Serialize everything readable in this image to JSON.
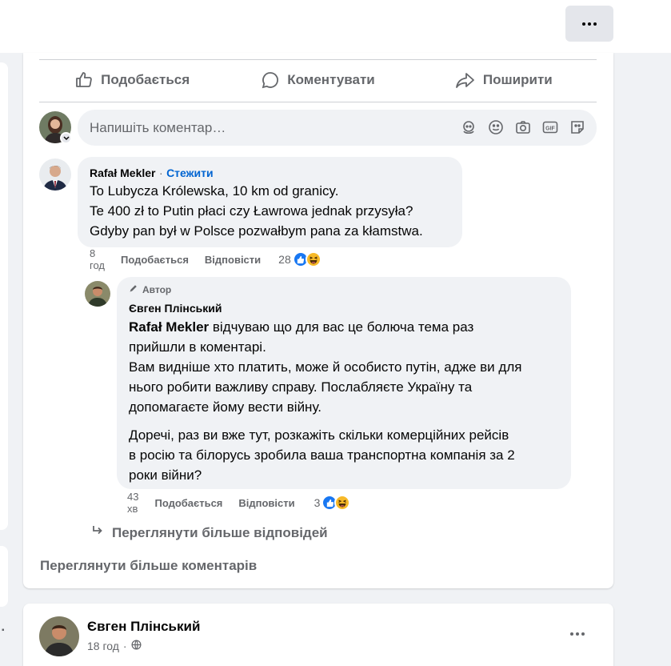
{
  "top": {
    "more_icon": "ellipsis-icon"
  },
  "actions": [
    {
      "label": "Подобається",
      "icon": "thumbs-up-icon"
    },
    {
      "label": "Коментувати",
      "icon": "comment-bubble-icon"
    },
    {
      "label": "Поширити",
      "icon": "share-arrow-icon"
    }
  ],
  "composer": {
    "placeholder": "Напишіть коментар…",
    "icons": [
      "avatar-sticker-icon",
      "emoji-icon",
      "camera-icon",
      "gif-icon",
      "sticker-icon"
    ]
  },
  "comments": [
    {
      "author": "Rafał Mekler",
      "follow": "Стежити",
      "separator": "·",
      "lines": [
        "To Lubycza Królewska, 10 km od granicy.",
        "Te 400 zł to Putin płaci czy Ławrowa jednak przysyła?",
        "Gdyby pan był w Polsce pozwałbym pana za kłamstwa."
      ],
      "time": "8 год",
      "like_label": "Подобається",
      "reply_label": "Відповісти",
      "reactions_count": "28"
    },
    {
      "badge": "Автор",
      "author": "Євген Плінський",
      "mention": "Rafał Mekler",
      "para1_first": " відчуваю що для вас це болюча тема раз",
      "para1_rest": [
        "прийшли в коментарі.",
        "Вам видніше хто платить, може й особисто путін, адже ви для",
        "нього робити важливу справу. Послабляєте Україну та",
        "допомагаєте йому вести війну."
      ],
      "para2": [
        "Доречі, раз ви вже тут, розкажіть скільки комерційних рейсів",
        "в росію та білорусь зробила ваша транспортна компанія за 2",
        "роки війни?"
      ],
      "time": "43 хв",
      "like_label": "Подобається",
      "reply_label": "Відповісти",
      "reactions_count": "3"
    }
  ],
  "view_more_replies": "Переглянути більше відповідей",
  "view_more_comments": "Переглянути більше коментарів",
  "next_post": {
    "author": "Євген Плінський",
    "time": "18 год",
    "separator": "·",
    "privacy_icon": "globe-icon"
  },
  "colors": {
    "link": "#0064d1",
    "like": "#1877f2",
    "bubble": "#f0f2f5",
    "muted": "#65676b"
  }
}
